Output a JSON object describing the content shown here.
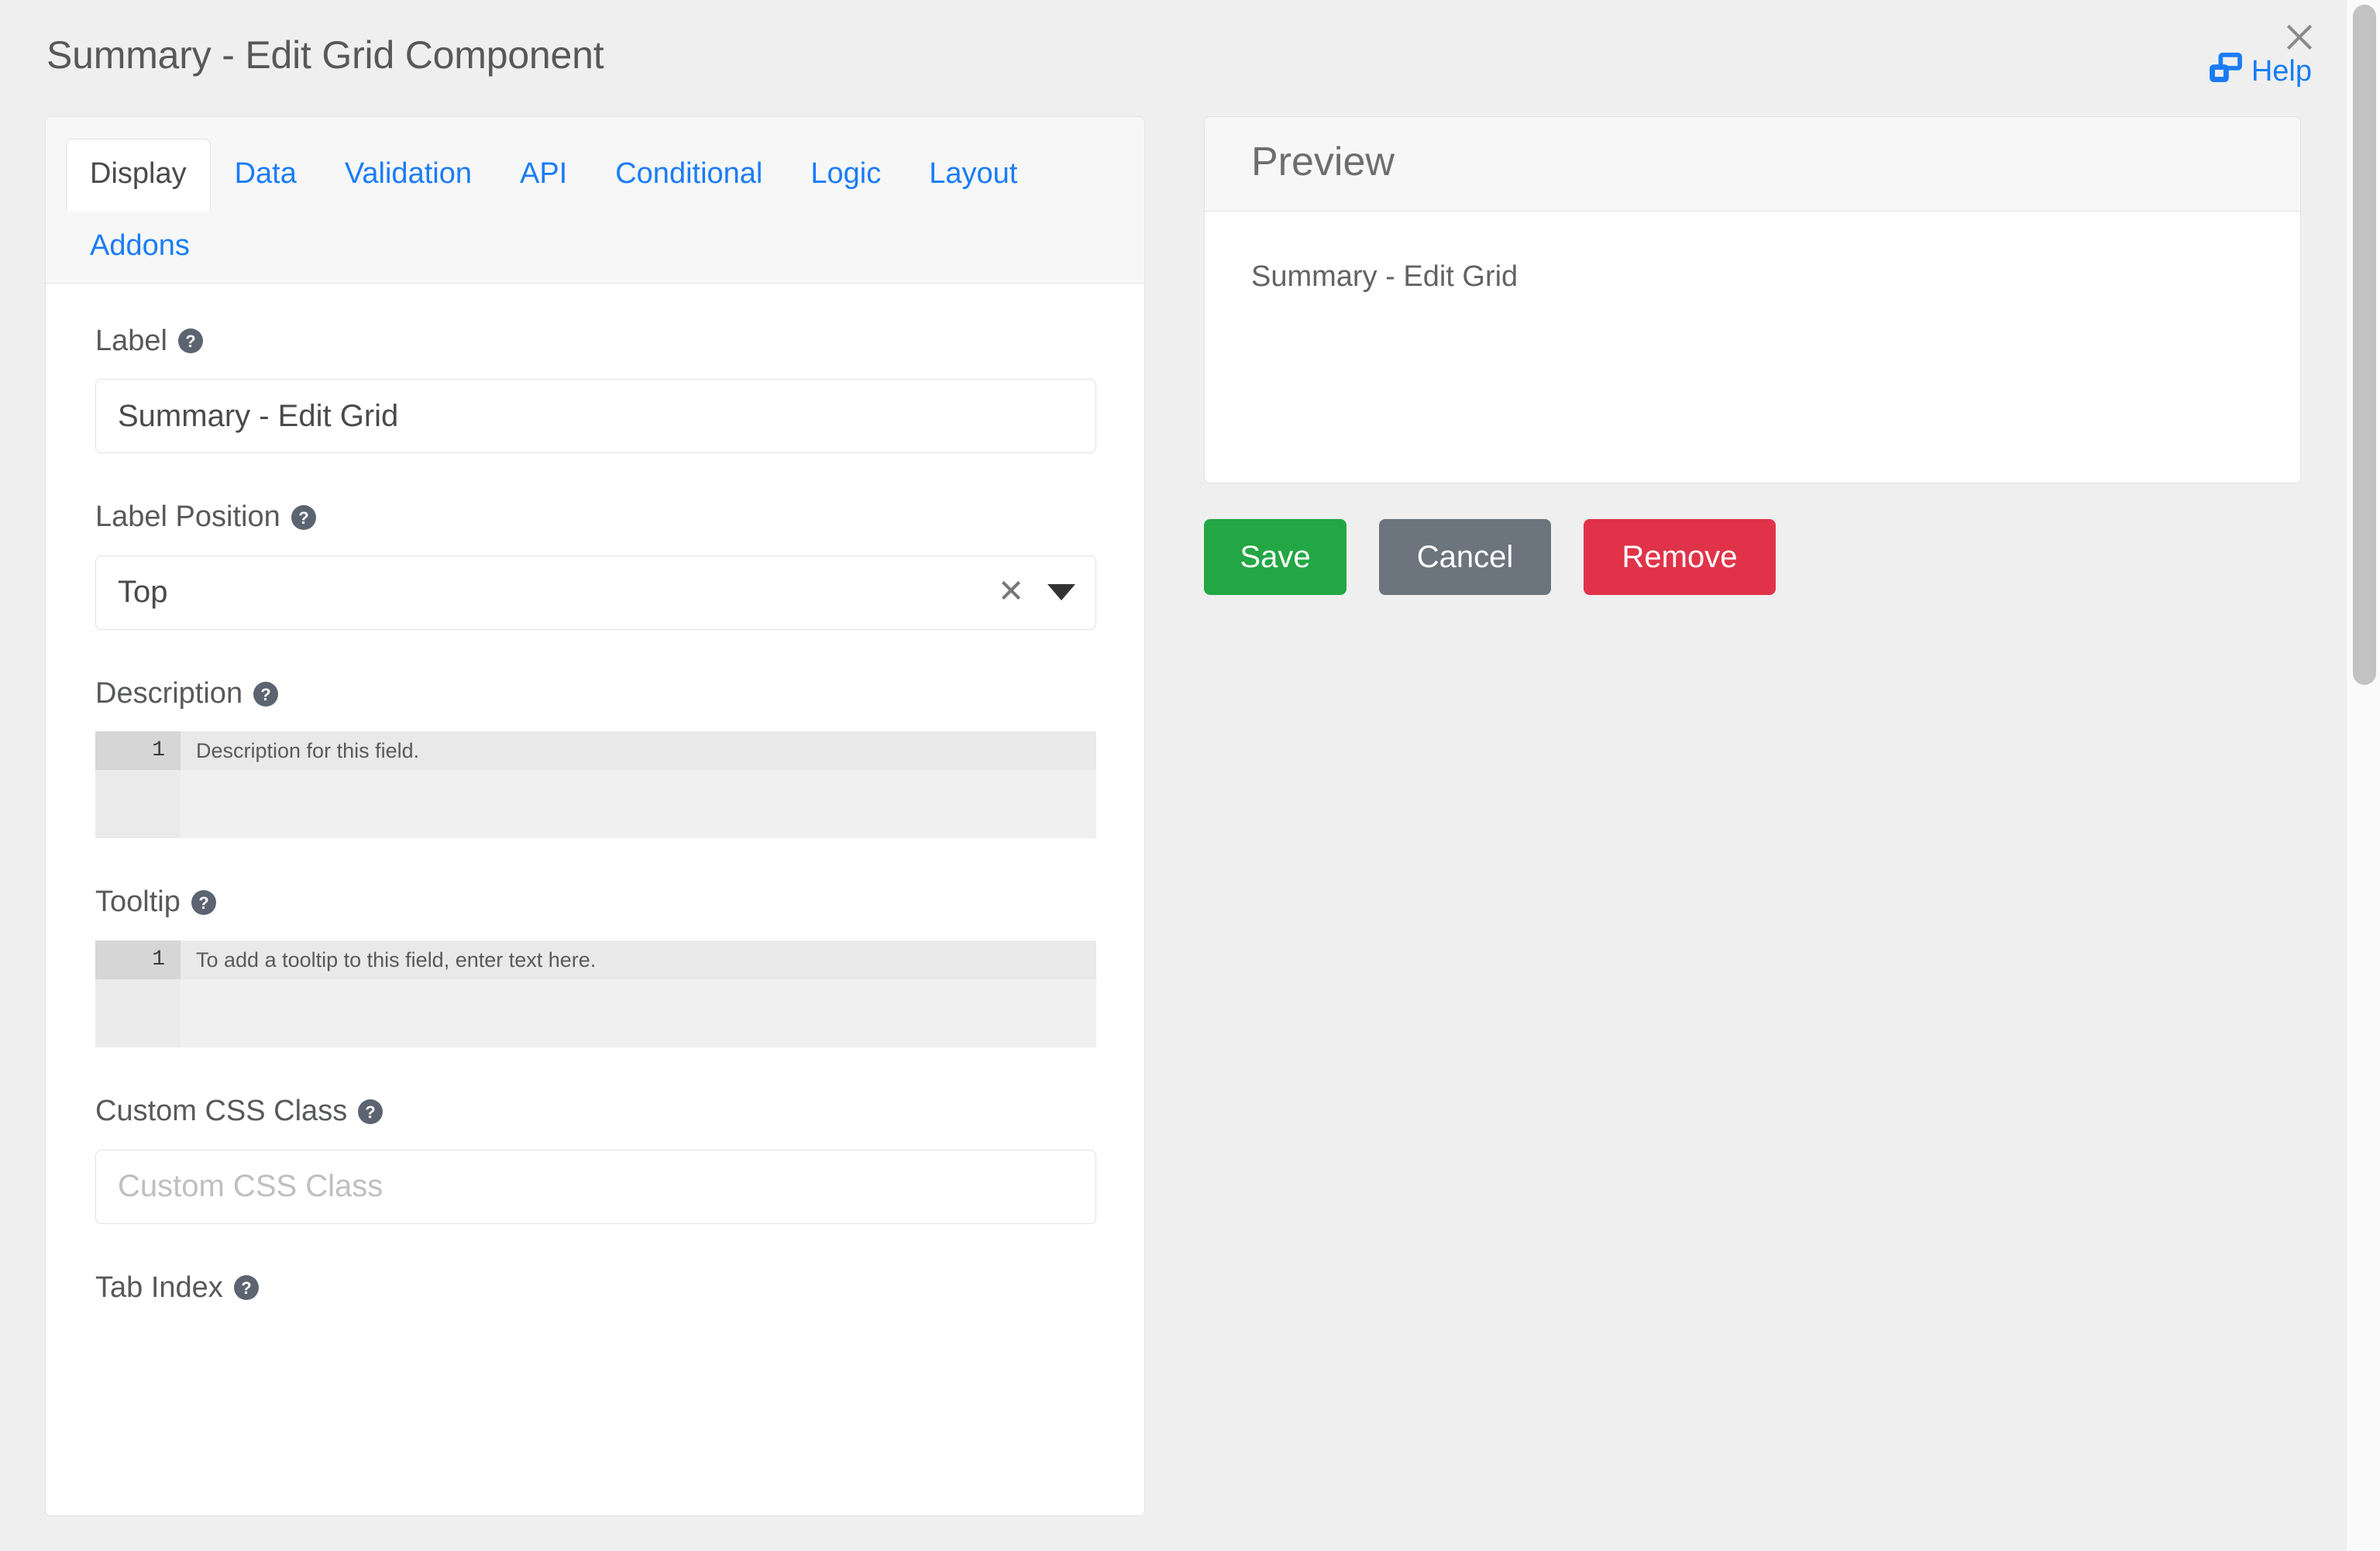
{
  "header": {
    "title": "Summary - Edit Grid Component",
    "help_label": "Help",
    "help_icon": "external-window-icon",
    "close_icon": "close-icon"
  },
  "tabs": [
    {
      "label": "Display",
      "active": true
    },
    {
      "label": "Data",
      "active": false
    },
    {
      "label": "Validation",
      "active": false
    },
    {
      "label": "API",
      "active": false
    },
    {
      "label": "Conditional",
      "active": false
    },
    {
      "label": "Logic",
      "active": false
    },
    {
      "label": "Layout",
      "active": false
    },
    {
      "label": "Addons",
      "active": false
    }
  ],
  "form": {
    "label_field": {
      "label": "Label",
      "help_icon": "question-mark-icon",
      "value": "Summary - Edit Grid",
      "placeholder": "Label"
    },
    "label_position": {
      "label": "Label Position",
      "help_icon": "question-mark-icon",
      "value": "Top",
      "clear_icon": "clear-x-icon",
      "caret_icon": "chevron-down-icon"
    },
    "description": {
      "label": "Description",
      "help_icon": "question-mark-icon",
      "line_number": "1",
      "placeholder": "Description for this field."
    },
    "tooltip": {
      "label": "Tooltip",
      "help_icon": "question-mark-icon",
      "line_number": "1",
      "placeholder": "To add a tooltip to this field, enter text here."
    },
    "custom_css_class": {
      "label": "Custom CSS Class",
      "help_icon": "question-mark-icon",
      "value": "",
      "placeholder": "Custom CSS Class"
    },
    "tab_index": {
      "label": "Tab Index",
      "help_icon": "question-mark-icon"
    }
  },
  "preview": {
    "title": "Preview",
    "field_label": "Summary - Edit Grid"
  },
  "actions": {
    "save_label": "Save",
    "cancel_label": "Cancel",
    "remove_label": "Remove"
  },
  "colors": {
    "link": "#1a7cf5",
    "save": "#23a744",
    "cancel": "#6c757d",
    "remove": "#e03349",
    "page_bg": "#efefef"
  }
}
